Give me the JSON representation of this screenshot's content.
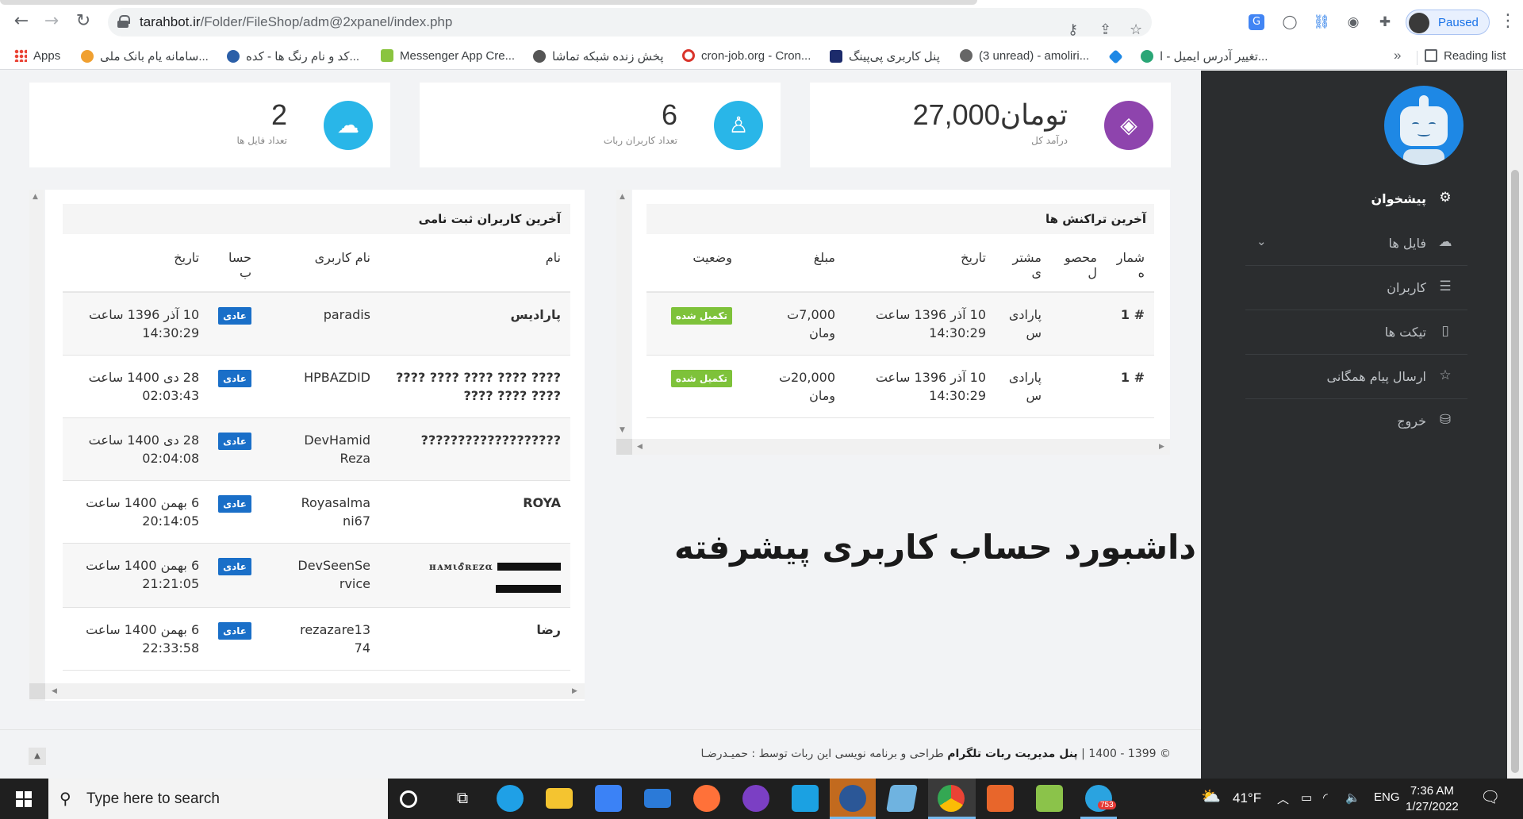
{
  "browser": {
    "url_host": "tarahbot.ir",
    "url_path": "/Folder/FileShop/adm@2xpanel/index.php",
    "profile_label": "Paused",
    "bookmarks": [
      {
        "label": "Apps",
        "color": "#ea4335"
      },
      {
        "label": "سامانه یام بانک ملی...",
        "color": "#f0a030"
      },
      {
        "label": "کد و نام رنگ ها - کده...",
        "color": "#2b5fa8"
      },
      {
        "label": "Messenger App Cre...",
        "color": "#8ac43f"
      },
      {
        "label": "پخش زنده شبکه تماشا",
        "color": "#555555"
      },
      {
        "label": "cron-job.org - Cron...",
        "color": "#d9342b"
      },
      {
        "label": "پنل کاربری پی‌پینگ",
        "color": "#1c2b6b"
      },
      {
        "label": "(3 unread) - amoliri...",
        "color": "#666666"
      },
      {
        "label": "",
        "color": "#1e88e5"
      },
      {
        "label": "تغییر آدرس ایمیل - ا...",
        "color": "#2aa676"
      }
    ],
    "reading_list": "Reading list"
  },
  "sidebar": {
    "items": [
      {
        "label": "پیشخوان",
        "icon": "gear-icon"
      },
      {
        "label": "فایل ها",
        "icon": "cloud-icon"
      },
      {
        "label": "کاربران",
        "icon": "list-icon"
      },
      {
        "label": "تیکت ها",
        "icon": "bucket-icon"
      },
      {
        "label": "ارسال پیام همگانی",
        "icon": "star-icon"
      },
      {
        "label": "خروج",
        "icon": "database-icon"
      }
    ]
  },
  "stats": [
    {
      "value": "27,000تومان",
      "label": "درآمد کل",
      "color": "#8e44ad",
      "icon": "ticket-icon"
    },
    {
      "value": "6",
      "label": "تعداد کاربران ربات",
      "color": "#29b6e8",
      "icon": "user-icon"
    },
    {
      "value": "2",
      "label": "تعداد فایل ها",
      "color": "#29b6e8",
      "icon": "cloud-icon"
    }
  ],
  "transactions": {
    "title": "آخرین تراکنش ها",
    "headers": [
      "شمار\nه",
      "محصو\nل",
      "مشتر\nی",
      "تاریخ",
      "مبلغ",
      "وضعیت"
    ],
    "rows": [
      {
        "num": "# 1",
        "product": "",
        "customer": "پارادی\nس",
        "date": "10 آذر 1396 ساعت\n14:30:29",
        "amount": "7,000ت\nومان",
        "status": "تکمیل شده"
      },
      {
        "num": "# 1",
        "product": "",
        "customer": "پارادی\nس",
        "date": "10 آذر 1396 ساعت\n14:30:29",
        "amount": "20,000ت\nومان",
        "status": "تکمیل شده"
      }
    ]
  },
  "users": {
    "title": "آخرین کاربران ثبت نامی",
    "headers": [
      "نام",
      "نام کاربری",
      "حسا\nب",
      "تاریخ"
    ],
    "rows": [
      {
        "name": "پارادیس",
        "username": "paradis",
        "type": "عادی",
        "date": "10 آذر 1396 ساعت\n14:30:29"
      },
      {
        "name": "???? ???? ???? ???? ????\n???? ???? ????",
        "username": "HPBAZDID",
        "type": "عادی",
        "date": "28 دی 1400 ساعت\n02:03:43"
      },
      {
        "name": "???????????????????",
        "username": "DevHamid\nReza",
        "type": "عادی",
        "date": "28 دی 1400 ساعت\n02:04:08"
      },
      {
        "name": "ROYA",
        "username": "Royasalma\nni67",
        "type": "عادی",
        "date": "6 بهمن 1400 ساعت\n20:14:05"
      },
      {
        "name": "ʜᴀᴍιᎴʀᴇᴢα",
        "username": "DevSeenSe\nrvice",
        "type": "عادی",
        "date": "6 بهمن 1400 ساعت\n21:21:05"
      },
      {
        "name": "رضا",
        "username": "rezazare13\n74",
        "type": "عادی",
        "date": "6 بهمن 1400 ساعت\n22:33:58"
      }
    ]
  },
  "promo_text": "دارای داشبورد حساب کاربری پیشرفته",
  "footer": {
    "copyright": "© 1399 - 1400 |",
    "brand": "پنل مدیریت ربات تلگرام",
    "credit": "طراحی و برنامه نویسی این ربات توسط : حمیـدرضـا"
  },
  "taskbar": {
    "search_placeholder": "Type here to search",
    "weather": "41°F",
    "lang": "ENG",
    "time": "7:36 AM",
    "date": "1/27/2022",
    "telegram_badge": "753",
    "apps": [
      {
        "name": "cortana-icon",
        "color": "#1f1f1f"
      },
      {
        "name": "task-view-icon",
        "color": "#1f1f1f"
      },
      {
        "name": "edge-icon",
        "color": "#1fa0e6"
      },
      {
        "name": "file-explorer-icon",
        "color": "#f4c430"
      },
      {
        "name": "store-icon",
        "color": "#3b82f6"
      },
      {
        "name": "mail-icon",
        "color": "#2b7ad8"
      },
      {
        "name": "firefox-icon",
        "color": "#ff7139"
      },
      {
        "name": "browser-icon",
        "color": "#7b3fc4"
      },
      {
        "name": "app-icon",
        "color": "#1ba1e2"
      },
      {
        "name": "word-icon",
        "color": "#2b5797"
      },
      {
        "name": "notepad-icon",
        "color": "#6fb3e0"
      },
      {
        "name": "chrome-icon",
        "color": "#4caf50"
      },
      {
        "name": "design-app-icon",
        "color": "#e8662b"
      },
      {
        "name": "notepadpp-icon",
        "color": "#8bc34a"
      },
      {
        "name": "telegram-icon",
        "color": "#2aa3e0"
      }
    ]
  }
}
